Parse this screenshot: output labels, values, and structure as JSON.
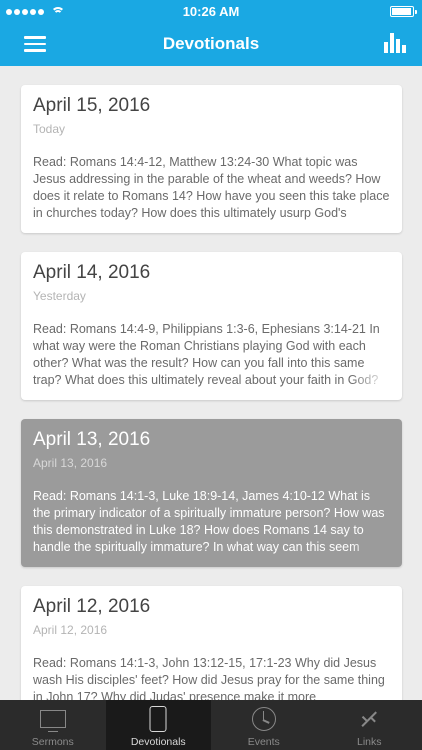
{
  "status_bar": {
    "time": "10:26 AM",
    "signal_dots": 5,
    "battery_level": 1.0
  },
  "nav": {
    "title": "Devotionals",
    "menu_icon": "hamburger-menu-icon",
    "stats_icon": "bar-chart-icon"
  },
  "devotionals": [
    {
      "title": "April 15, 2016",
      "subtitle": "Today",
      "body": "Read:  Romans 14:4-12, Matthew 13:24-30 What topic was Jesus addressing in the parable of the wheat and weeds? How does it relate to Romans 14? How have you seen this take place in churches today? How does this ultimately usurp God's",
      "selected": false
    },
    {
      "title": "April 14, 2016",
      "subtitle": "Yesterday",
      "body": "Read:  Romans 14:4-9, Philippians 1:3-6, Ephesians 3:14-21 In what way were the Roman Christians playing God with each other? What was the result? How can you fall into this same trap? What does this ultimately reveal about your faith in God?",
      "selected": false
    },
    {
      "title": "April 13, 2016",
      "subtitle": "April 13, 2016",
      "body": "Read:  Romans 14:1-3, Luke 18:9-14, James 4:10-12 What is the primary indicator of a spiritually immature person? How was this demonstrated in Luke 18? How does Romans 14 say to handle the spiritually immature? In what way can this seem",
      "selected": true
    },
    {
      "title": "April 12, 2016",
      "subtitle": "April 12, 2016",
      "body": "Read:  Romans 14:1-3, John 13:12-15, 17:1-23 Why did Jesus wash His disciples' feet? How did Jesus pray for the same thing in John 17? Why did Judas' presence make it more",
      "selected": false
    }
  ],
  "tabs": [
    {
      "label": "Sermons",
      "icon": "tv-icon",
      "active": false
    },
    {
      "label": "Devotionals",
      "icon": "phone-icon",
      "active": true
    },
    {
      "label": "Events",
      "icon": "clock-icon",
      "active": false
    },
    {
      "label": "Links",
      "icon": "links-icon",
      "active": false
    }
  ],
  "colors": {
    "header": "#1aa8e3",
    "tabbar": "#2b2b2b",
    "selected_card": "#9b9b9b"
  }
}
